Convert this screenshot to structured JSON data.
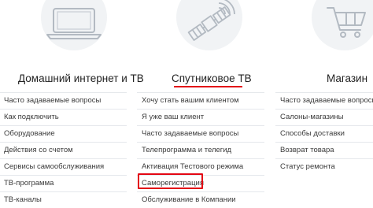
{
  "columns": [
    {
      "title": "Домашний интернет и ТВ",
      "icon": "laptop-icon",
      "items": [
        "Часто задаваемые вопросы",
        "Как подключить",
        "Оборудование",
        "Действия со счетом",
        "Сервисы самообслуживания",
        "ТВ-программа",
        "ТВ-каналы"
      ]
    },
    {
      "title": "Спутниковое ТВ",
      "icon": "satellite-icon",
      "items": [
        "Хочу стать вашим клиентом",
        "Я уже ваш клиент",
        "Часто задаваемые вопросы",
        "Телепрограмма и телегид",
        "Активация Тестового режима",
        "Саморегистрация",
        "Обслуживание в Компании"
      ]
    },
    {
      "title": "Магазин",
      "icon": "shopping-cart-icon",
      "items": [
        "Часто задаваемые вопросы",
        "Салоны-магазины",
        "Способы доставки",
        "Возврат товара",
        "Статус ремонта"
      ]
    }
  ],
  "colors": {
    "accent": "#e30613",
    "icon_stroke": "#b3bac2",
    "icon_background": "#f1f3f5"
  }
}
